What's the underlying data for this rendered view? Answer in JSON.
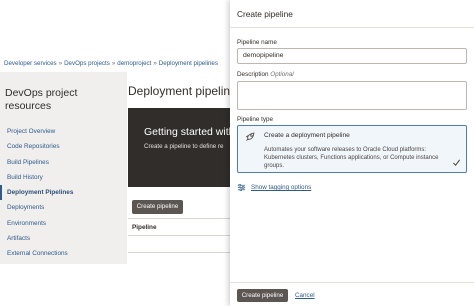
{
  "background": {
    "breadcrumb": [
      "Developer services",
      "DevOps projects",
      "demoproject",
      "Deployment pipelines"
    ],
    "breadcrumb_separator": "»",
    "sidebar": {
      "title_line1": "DevOps project",
      "title_line2": "resources",
      "items": [
        {
          "label": "Project Overview",
          "active": false
        },
        {
          "label": "Code Repositories",
          "active": false
        },
        {
          "label": "Build Pipelines",
          "active": false
        },
        {
          "label": "Build History",
          "active": false
        },
        {
          "label": "Deployment Pipelines",
          "active": true
        },
        {
          "label": "Deployments",
          "active": false
        },
        {
          "label": "Environments",
          "active": false
        },
        {
          "label": "Artifacts",
          "active": false
        },
        {
          "label": "External Connections",
          "active": false
        }
      ]
    },
    "main": {
      "title": "Deployment pipelines",
      "hero_title": "Getting started with",
      "hero_subtitle": "Create a pipeline to define re",
      "create_button": "Create pipeline",
      "table_header": "Pipeline"
    }
  },
  "panel": {
    "title": "Create pipeline",
    "name_label": "Pipeline name",
    "name_value": "demopipeline",
    "description_label": "Description",
    "description_optional": "Optional",
    "type_label": "Pipeline type",
    "type_option": {
      "title": "Create a deployment pipeline",
      "description": "Automates your software releases to Oracle Cloud platforms: Kubernetes clusters, Functions applications, or Compute instance groups.",
      "selected": true,
      "icon": "rocket-icon"
    },
    "tagging_link": "Show tagging options",
    "submit_button": "Create pipeline",
    "cancel_link": "Cancel"
  },
  "colors": {
    "accent_link": "#2f5a8c",
    "dark_button": "#5b5651",
    "hero_bg": "#312d2a",
    "sidebar_bg": "#f1efed",
    "selected_card_border": "#4d7eaf"
  }
}
